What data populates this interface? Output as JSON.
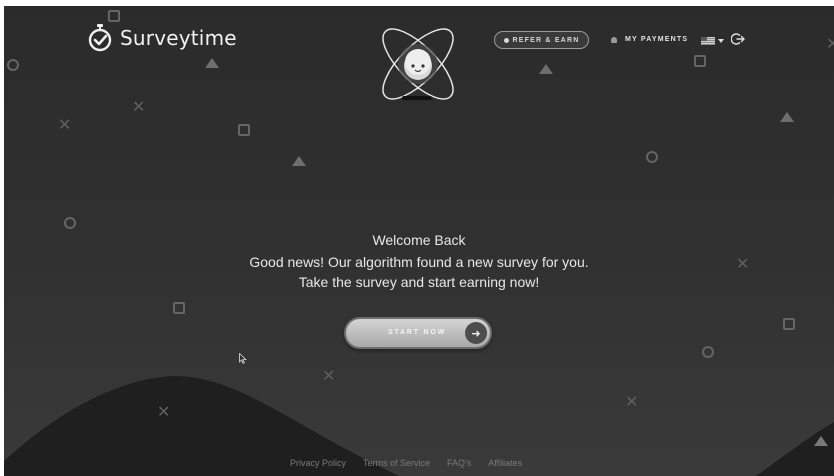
{
  "app": {
    "brand": "Surveytime"
  },
  "header": {
    "refer_label": "REFER & EARN",
    "payments_label": "MY PAYMENTS"
  },
  "icons": {
    "logo": "stopwatch-check-icon",
    "mascot": "atom-mascot-icon",
    "refer": "dot-icon",
    "bell": "bell-icon",
    "flag": "us-flag-icon",
    "caret": "chevron-down-icon",
    "logout": "logout-icon",
    "start_arrow": "arrow-right-icon",
    "cursor": "mouse-pointer-icon"
  },
  "main": {
    "welcome_title": "Welcome Back",
    "message_line1": "Good news! Our algorithm found a new survey for you.",
    "message_line2": "Take the survey and start earning now!",
    "start_label": "START NOW",
    "start_arrow": "➜"
  },
  "footer": {
    "links": [
      "Privacy Policy",
      "Terms of Service",
      "FAQ's",
      "Affiliates"
    ]
  },
  "colors": {
    "background_top": "#2b2b2b",
    "background_bottom": "#3a3a3a",
    "text": "#e8e8e8",
    "button_light": "#d4d4d4",
    "button_dark": "#a9a9a9"
  }
}
